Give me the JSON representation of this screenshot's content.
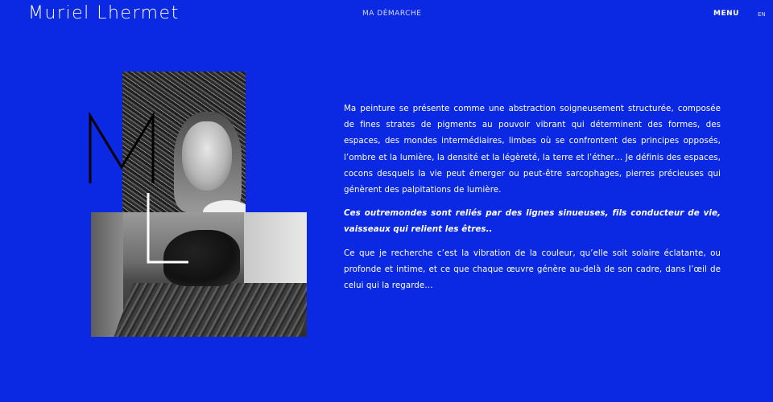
{
  "header": {
    "site_title": "Muriel Lhermet",
    "nav_link": "MA DÉMARCHE",
    "menu_label": "MENU",
    "lang_label": "EN"
  },
  "colors": {
    "background": "#0b29e2",
    "text": "#ffffff",
    "monogram_m": "#000000",
    "monogram_l": "#ffffff"
  },
  "monogram": {
    "m": "M",
    "l": "L"
  },
  "images": {
    "portrait": "portrait photo of the artist (black & white)",
    "studio": "artist painting on the studio floor (black & white)"
  },
  "content": {
    "paragraph1": "Ma peinture se présente comme une abstraction soigneusement structurée, composée de fines strates de pigments au pouvoir vibrant qui déterminent des formes, des espaces, des mondes intermédiaires, limbes où se confrontent des principes opposés, l’ombre et la lumière, la densité et la légèreté, la terre et l’éther… Je définis des espaces, cocons desquels la vie peut émerger ou peut-être sarcophages, pierres précieuses qui génèrent des palpitations de lumière.",
    "quote": "Ces outremondes sont reliés par des lignes sinueuses, fils conducteur de vie, vaisseaux qui relient les êtres..",
    "paragraph2": "Ce que je recherche c’est la vibration de la couleur, qu’elle soit solaire éclatante, ou profonde et intime, et ce que chaque œuvre génère au-delà de son cadre, dans l’œil de celui qui la regarde…"
  }
}
